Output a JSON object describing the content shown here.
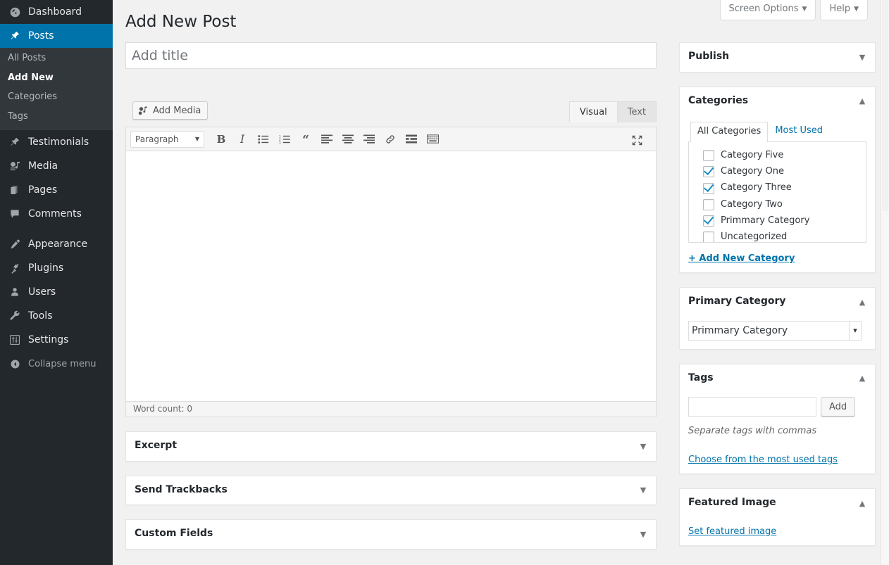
{
  "sidebar": {
    "items": [
      {
        "label": "Dashboard",
        "icon": "dashboard-icon",
        "current": false
      },
      {
        "label": "Posts",
        "icon": "pin-icon",
        "current": true
      },
      {
        "label": "Testimonials",
        "icon": "pin-icon",
        "current": false
      },
      {
        "label": "Media",
        "icon": "media-icon",
        "current": false
      },
      {
        "label": "Pages",
        "icon": "pages-icon",
        "current": false
      },
      {
        "label": "Comments",
        "icon": "comments-icon",
        "current": false
      },
      {
        "label": "Appearance",
        "icon": "brush-icon",
        "current": false
      },
      {
        "label": "Plugins",
        "icon": "plug-icon",
        "current": false
      },
      {
        "label": "Users",
        "icon": "user-icon",
        "current": false
      },
      {
        "label": "Tools",
        "icon": "wrench-icon",
        "current": false
      },
      {
        "label": "Settings",
        "icon": "sliders-icon",
        "current": false
      }
    ],
    "posts_submenu": [
      {
        "label": "All Posts",
        "current": false
      },
      {
        "label": "Add New",
        "current": true
      },
      {
        "label": "Categories",
        "current": false
      },
      {
        "label": "Tags",
        "current": false
      }
    ],
    "collapse_label": "Collapse menu",
    "collapse_icon": "collapse-arrow-icon",
    "active_color": "#0073aa",
    "background": "#23282d",
    "submenu_background": "#32373c"
  },
  "screen_meta": {
    "screen_options_label": "Screen Options",
    "help_label": "Help",
    "caret": "▼"
  },
  "page": {
    "title": "Add New Post"
  },
  "title_field": {
    "value": "",
    "placeholder": "Add title"
  },
  "editor": {
    "add_media_label": "Add Media",
    "add_media_icon": "media-add-icon",
    "tabs": [
      {
        "label": "Visual",
        "active": true
      },
      {
        "label": "Text",
        "active": false
      }
    ],
    "format_select": {
      "value": "Paragraph",
      "caret": "▼"
    },
    "toolbar_buttons": [
      {
        "name": "bold-icon",
        "label": "B"
      },
      {
        "name": "italic-icon",
        "label": "I"
      },
      {
        "name": "bulleted-list-icon",
        "label": ""
      },
      {
        "name": "numbered-list-icon",
        "label": ""
      },
      {
        "name": "blockquote-icon",
        "label": "“"
      },
      {
        "name": "align-left-icon",
        "label": ""
      },
      {
        "name": "align-center-icon",
        "label": ""
      },
      {
        "name": "align-right-icon",
        "label": ""
      },
      {
        "name": "link-icon",
        "label": ""
      },
      {
        "name": "read-more-icon",
        "label": ""
      },
      {
        "name": "toolbar-toggle-icon",
        "label": ""
      }
    ],
    "fullscreen_icon": "fullscreen-icon",
    "content": "",
    "word_count_label": "Word count: 0"
  },
  "content_metaboxes": [
    {
      "title": "Excerpt",
      "collapsed": true,
      "caret": "▼"
    },
    {
      "title": "Send Trackbacks",
      "collapsed": true,
      "caret": "▼"
    },
    {
      "title": "Custom Fields",
      "collapsed": true,
      "caret": "▼"
    }
  ],
  "side": {
    "publish": {
      "title": "Publish",
      "collapsed": true,
      "caret": "▼"
    },
    "categories": {
      "title": "Categories",
      "collapsed": false,
      "caret": "▲",
      "tabs": [
        {
          "label": "All Categories",
          "active": true
        },
        {
          "label": "Most Used",
          "active": false
        }
      ],
      "items": [
        {
          "label": "Category Five",
          "checked": false
        },
        {
          "label": "Category One",
          "checked": true
        },
        {
          "label": "Category Three",
          "checked": true
        },
        {
          "label": "Category Two",
          "checked": false
        },
        {
          "label": "Primmary Category",
          "checked": true
        },
        {
          "label": "Uncategorized",
          "checked": false
        }
      ],
      "add_new_label": "+ Add New Category"
    },
    "primary_category": {
      "title": "Primary Category",
      "collapsed": false,
      "caret": "▲",
      "selected": "Primmary Category",
      "options": [
        "Primmary Category"
      ]
    },
    "tags": {
      "title": "Tags",
      "collapsed": false,
      "caret": "▲",
      "input_value": "",
      "add_label": "Add",
      "hint": "Separate tags with commas",
      "cloud_link": "Choose from the most used tags"
    },
    "featured_image": {
      "title": "Featured Image",
      "collapsed": false,
      "caret": "▲",
      "set_link": "Set featured image"
    }
  },
  "colors": {
    "accent": "#0073aa",
    "link": "#0073aa",
    "admin_bg": "#f1f1f1",
    "checkbox_check": "#1e8cbe"
  }
}
